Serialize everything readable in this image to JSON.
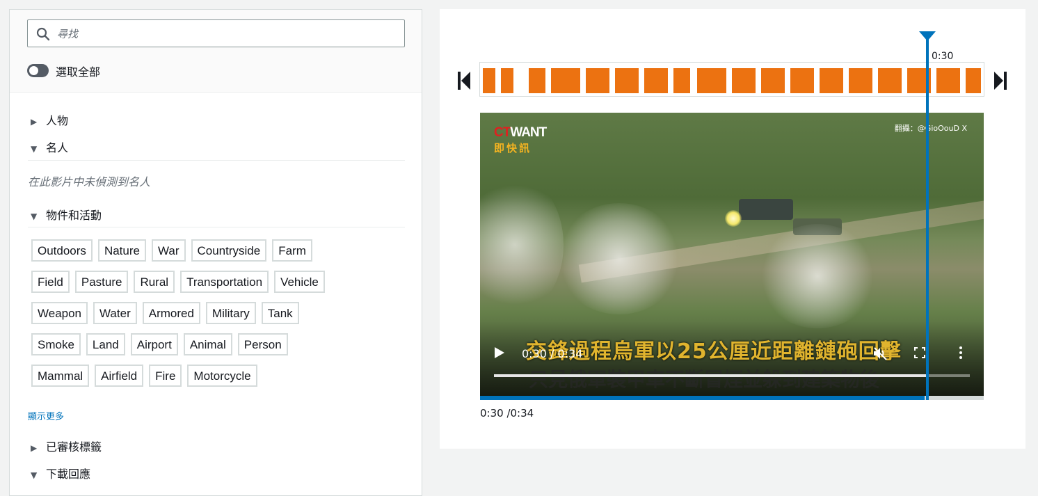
{
  "search": {
    "placeholder": "尋找",
    "value": ""
  },
  "select_all": {
    "label": "選取全部",
    "on": false
  },
  "sections": {
    "people": "人物",
    "celebrities": "名人",
    "celebrities_empty": "在此影片中未偵測到名人",
    "objects": "物件和活動",
    "show_more": "顯示更多",
    "moderation": "已審核標籤",
    "download": "下載回應"
  },
  "tags": [
    [
      "Outdoors",
      "Nature",
      "War",
      "Countryside",
      "Farm"
    ],
    [
      "Field",
      "Pasture",
      "Rural",
      "Transportation",
      "Vehicle"
    ],
    [
      "Weapon",
      "Water",
      "Armored",
      "Military",
      "Tank"
    ],
    [
      "Smoke",
      "Land",
      "Airport",
      "Animal",
      "Person"
    ],
    [
      "Mammal",
      "Airfield",
      "Fire",
      "Motorcycle"
    ]
  ],
  "timeline": {
    "marker_label": "0:30",
    "progress_fraction": 0.882,
    "readout": "0:30 /0:34"
  },
  "video": {
    "logo_top_red": "CT",
    "logo_top_white": "WANT",
    "logo_bottom": "即快訊",
    "credit": "翻攝：@GioOouD X",
    "subtitle": "交鋒過程烏軍以25公厘近距離鏈砲回擊",
    "subtitle2": "只見俄軍裝甲車不斷冒煙並躲到建築物後",
    "time": "0:30 / 0:34",
    "progress_fraction": 0.91
  },
  "colors": {
    "accent": "#0073bb",
    "frame": "#ec7211",
    "tag_border": "#d5dbdb"
  }
}
